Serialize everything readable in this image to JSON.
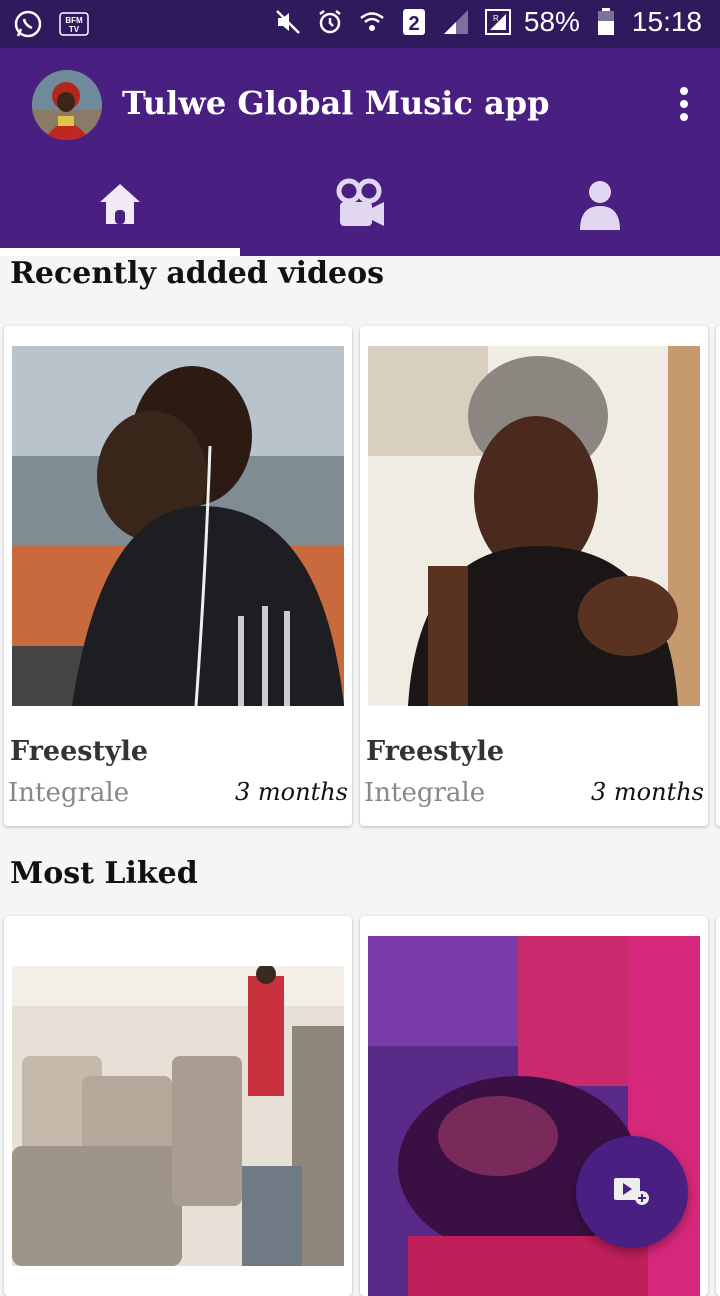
{
  "status_bar": {
    "battery": "58%",
    "time": "15:18",
    "left_icons": [
      "whatsapp-icon",
      "bfm-tv-icon"
    ],
    "right_icons": [
      "mute-icon",
      "alarm-icon",
      "wifi-icon",
      "sim-2-icon",
      "signal-icon",
      "roaming-signal-icon",
      "battery-icon"
    ],
    "sim_number": "2",
    "bfm_label": "BFM TV"
  },
  "app_bar": {
    "title": "Tulwe Global Music app",
    "menu_icon": "more-vert-icon"
  },
  "tabs": [
    {
      "icon": "home-icon",
      "selected": true
    },
    {
      "icon": "video-camera-icon",
      "selected": false
    },
    {
      "icon": "person-icon",
      "selected": false
    }
  ],
  "recent": {
    "title": "Recently added videos",
    "cards": [
      {
        "title": "Freestyle",
        "subtitle": "Integrale",
        "age": "3 months"
      },
      {
        "title": "Freestyle",
        "subtitle": "Integrale",
        "age": "3 months"
      }
    ]
  },
  "most_liked": {
    "title": "Most Liked"
  },
  "fab": {
    "icon": "add-video-icon"
  },
  "colors": {
    "primary": "#4a1f82",
    "status_bar": "#2e1a5c"
  }
}
